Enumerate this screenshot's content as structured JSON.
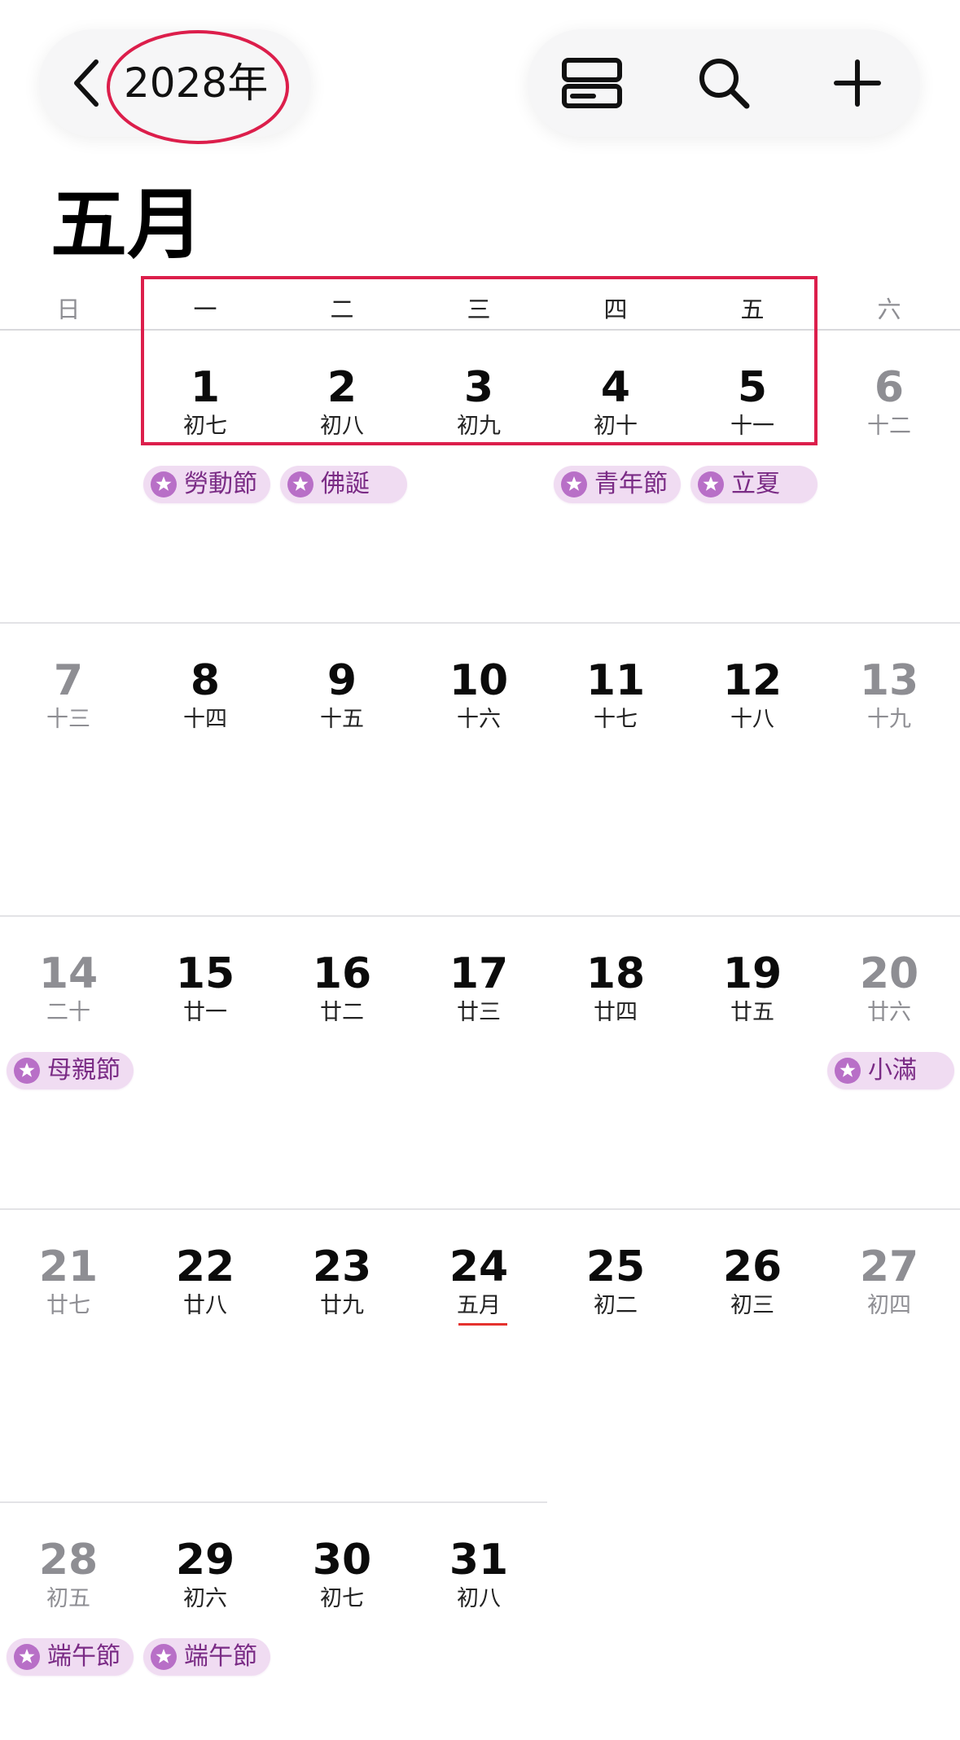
{
  "header": {
    "year_label": "2028年",
    "icons": {
      "back": "chevron-left-icon",
      "list": "list-view-icon",
      "search": "search-icon",
      "add": "plus-icon"
    }
  },
  "month_title": "五月",
  "weekdays": [
    "日",
    "一",
    "二",
    "三",
    "四",
    "五",
    "六"
  ],
  "weeks": [
    {
      "days": [
        null,
        {
          "num": "1",
          "lunar": "初七"
        },
        {
          "num": "2",
          "lunar": "初八"
        },
        {
          "num": "3",
          "lunar": "初九"
        },
        {
          "num": "4",
          "lunar": "初十"
        },
        {
          "num": "5",
          "lunar": "十一"
        },
        {
          "num": "6",
          "lunar": "十二"
        }
      ],
      "events": [
        {
          "label": "勞動節",
          "col": 1
        },
        {
          "label": "佛誕",
          "col": 2
        },
        {
          "label": "青年節",
          "col": 4
        },
        {
          "label": "立夏",
          "col": 5
        }
      ]
    },
    {
      "days": [
        {
          "num": "7",
          "lunar": "十三"
        },
        {
          "num": "8",
          "lunar": "十四"
        },
        {
          "num": "9",
          "lunar": "十五"
        },
        {
          "num": "10",
          "lunar": "十六"
        },
        {
          "num": "11",
          "lunar": "十七"
        },
        {
          "num": "12",
          "lunar": "十八"
        },
        {
          "num": "13",
          "lunar": "十九"
        }
      ],
      "events": []
    },
    {
      "days": [
        {
          "num": "14",
          "lunar": "二十"
        },
        {
          "num": "15",
          "lunar": "廿一"
        },
        {
          "num": "16",
          "lunar": "廿二"
        },
        {
          "num": "17",
          "lunar": "廿三"
        },
        {
          "num": "18",
          "lunar": "廿四"
        },
        {
          "num": "19",
          "lunar": "廿五"
        },
        {
          "num": "20",
          "lunar": "廿六"
        }
      ],
      "events": [
        {
          "label": "母親節",
          "col": 0
        },
        {
          "label": "小滿",
          "col": 6
        }
      ]
    },
    {
      "days": [
        {
          "num": "21",
          "lunar": "廿七"
        },
        {
          "num": "22",
          "lunar": "廿八"
        },
        {
          "num": "23",
          "lunar": "廿九"
        },
        {
          "num": "24",
          "lunar": "五月",
          "underline": true
        },
        {
          "num": "25",
          "lunar": "初二"
        },
        {
          "num": "26",
          "lunar": "初三"
        },
        {
          "num": "27",
          "lunar": "初四"
        }
      ],
      "events": []
    },
    {
      "days": [
        {
          "num": "28",
          "lunar": "初五"
        },
        {
          "num": "29",
          "lunar": "初六"
        },
        {
          "num": "30",
          "lunar": "初七"
        },
        {
          "num": "31",
          "lunar": "初八"
        },
        null,
        null,
        null
      ],
      "events": [
        {
          "label": "端午節",
          "col": 0
        },
        {
          "label": "端午節",
          "col": 1
        }
      ]
    }
  ],
  "colors": {
    "annotation_red": "#dc1e4b",
    "weekend_gray": "#8e8e93",
    "chip_bg": "#f0dcf2",
    "chip_text": "#7a2b85",
    "chip_icon": "#b86fc7",
    "lunar_month_underline": "#e5322e"
  }
}
